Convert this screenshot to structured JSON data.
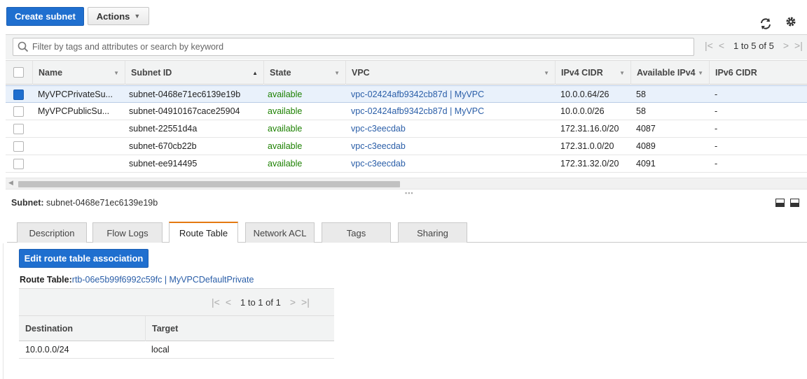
{
  "toolbar": {
    "create_label": "Create subnet",
    "actions_label": "Actions",
    "refresh_icon": "refresh-icon",
    "settings_icon": "gear-icon"
  },
  "filter": {
    "placeholder": "Filter by tags and attributes or search by keyword",
    "pager_text": "1 to 5 of 5"
  },
  "table": {
    "columns": [
      "Name",
      "Subnet ID",
      "State",
      "VPC",
      "IPv4 CIDR",
      "Available IPv4",
      "IPv6 CIDR"
    ],
    "rows": [
      {
        "selected": true,
        "name": "MyVPCPrivateSu...",
        "subnet_id": "subnet-0468e71ec6139e19b",
        "state": "available",
        "vpc": "vpc-02424afb9342cb87d | MyVPC",
        "ipv4": "10.0.0.64/26",
        "available": "58",
        "ipv6": "-"
      },
      {
        "selected": false,
        "name": "MyVPCPublicSu...",
        "subnet_id": "subnet-04910167cace25904",
        "state": "available",
        "vpc": "vpc-02424afb9342cb87d | MyVPC",
        "ipv4": "10.0.0.0/26",
        "available": "58",
        "ipv6": "-"
      },
      {
        "selected": false,
        "name": "",
        "subnet_id": "subnet-22551d4a",
        "state": "available",
        "vpc": "vpc-c3eecdab",
        "ipv4": "172.31.16.0/20",
        "available": "4087",
        "ipv6": "-"
      },
      {
        "selected": false,
        "name": "",
        "subnet_id": "subnet-670cb22b",
        "state": "available",
        "vpc": "vpc-c3eecdab",
        "ipv4": "172.31.0.0/20",
        "available": "4089",
        "ipv6": "-"
      },
      {
        "selected": false,
        "name": "",
        "subnet_id": "subnet-ee914495",
        "state": "available",
        "vpc": "vpc-c3eecdab",
        "ipv4": "172.31.32.0/20",
        "available": "4091",
        "ipv6": "-"
      }
    ]
  },
  "detail": {
    "subnet_prefix": "Subnet:",
    "subnet_value": "subnet-0468e71ec6139e19b",
    "tabs": [
      "Description",
      "Flow Logs",
      "Route Table",
      "Network ACL",
      "Tags",
      "Sharing"
    ],
    "active_tab": "Route Table",
    "edit_label": "Edit route table association",
    "route_table_prefix": "Route Table:",
    "route_table_link": "rtb-06e5b99f6992c59fc | MyVPCDefaultPrivate",
    "rt_pager_text": "1 to 1 of 1",
    "rt_columns": [
      "Destination",
      "Target"
    ],
    "rt_rows": [
      {
        "destination": "10.0.0.0/24",
        "target": "local"
      }
    ]
  },
  "colors": {
    "primary": "#1f6fcf",
    "available": "#1d8102",
    "link": "#2a5ea8",
    "active_tab_accent": "#e47911"
  }
}
